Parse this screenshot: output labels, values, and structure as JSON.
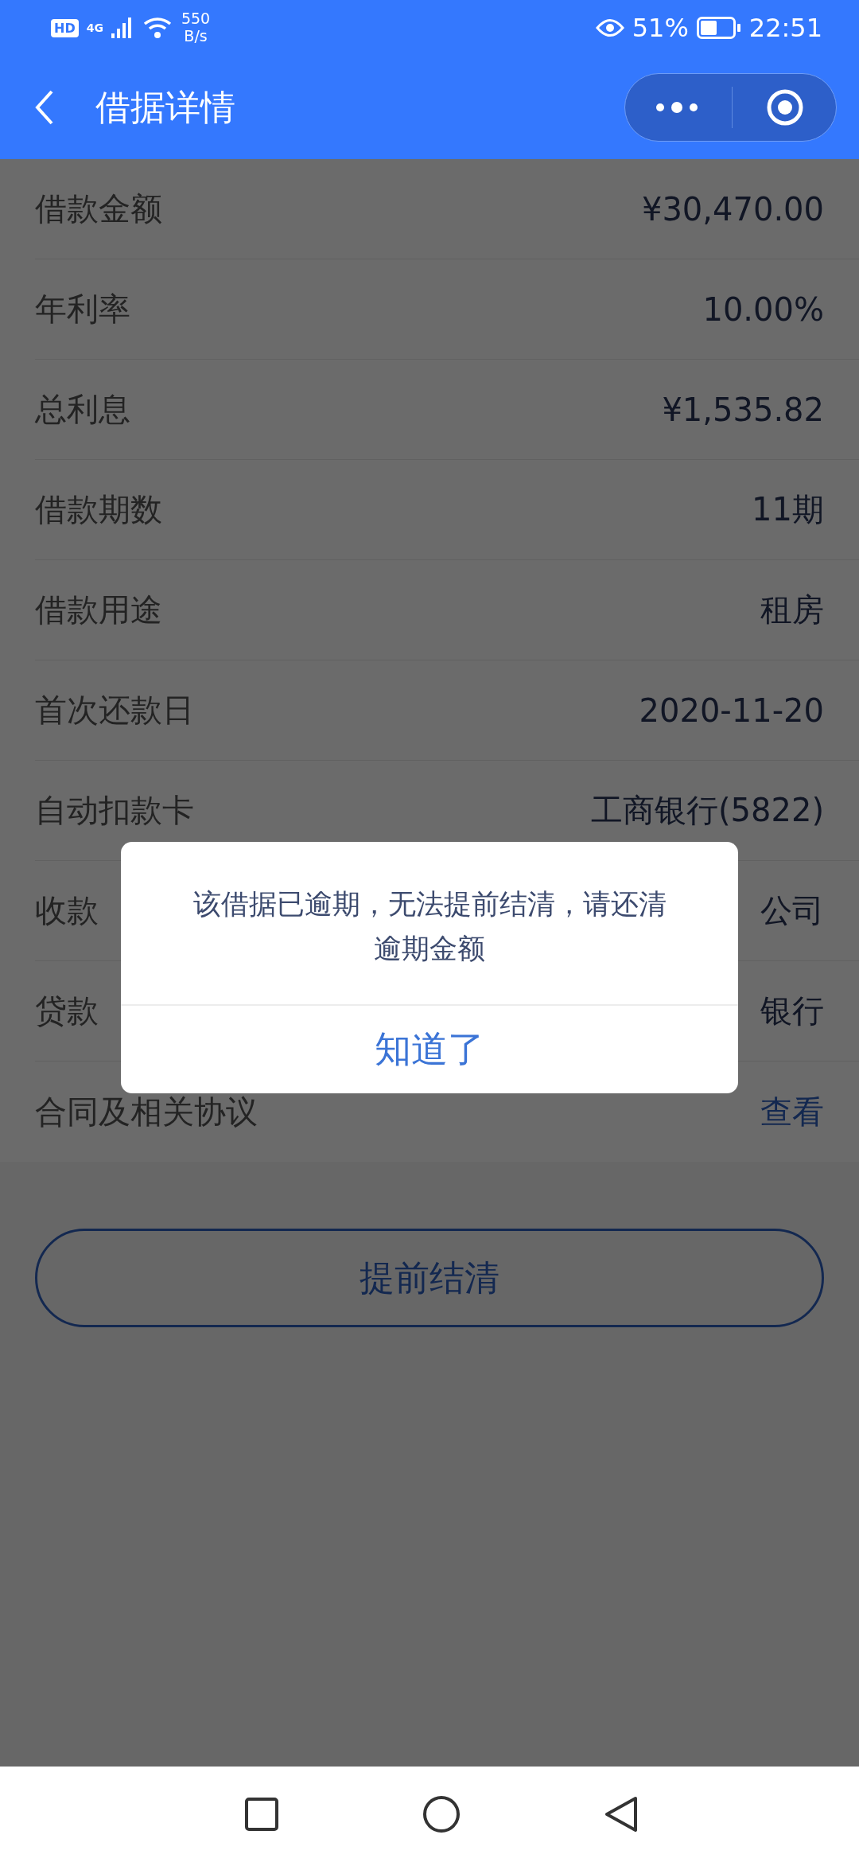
{
  "status_bar": {
    "hd_label": "HD",
    "network": "4G",
    "speed_value": "550",
    "speed_unit": "B/s",
    "battery_percent": "51%",
    "time": "22:51"
  },
  "nav": {
    "title": "借据详情"
  },
  "rows": [
    {
      "label": "借款金额",
      "value": "¥30,470.00",
      "kind": "text"
    },
    {
      "label": "年利率",
      "value": "10.00%",
      "kind": "text"
    },
    {
      "label": "总利息",
      "value": "¥1,535.82",
      "kind": "text"
    },
    {
      "label": "借款期数",
      "value": "11期",
      "kind": "text"
    },
    {
      "label": "借款用途",
      "value": "租房",
      "kind": "text"
    },
    {
      "label": "首次还款日",
      "value": "2020-11-20",
      "kind": "text"
    },
    {
      "label": "自动扣款卡",
      "value": "工商银行(5822)",
      "kind": "text"
    },
    {
      "label": "收款",
      "value": "公司",
      "kind": "text"
    },
    {
      "label": "贷款",
      "value": "银行",
      "kind": "text"
    },
    {
      "label": "合同及相关协议",
      "value": "查看",
      "kind": "link"
    }
  ],
  "settle_button": "提前结清",
  "dialog": {
    "message": "该借据已逾期，无法提前结清，请还清逾期金额",
    "button": "知道了"
  }
}
